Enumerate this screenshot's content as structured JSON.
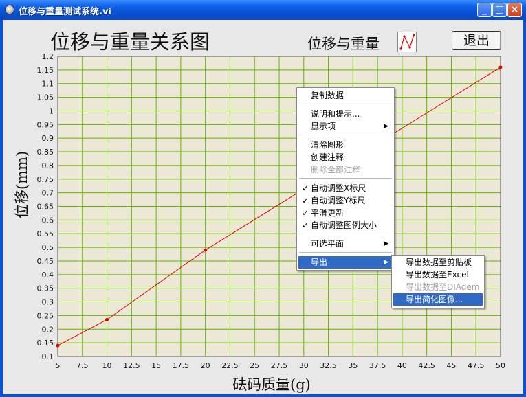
{
  "window": {
    "title": "位移与重量测试系统.vi"
  },
  "chart_title": "位移与重量关系图",
  "legend_label": "位移与重量",
  "exit_button": "退出",
  "context_menu": {
    "copy_data": "复制数据",
    "description": "说明和提示...",
    "visible_items": "显示项",
    "clear_graph": "清除图形",
    "create_annotation": "创建注释",
    "delete_annotations": "删除全部注释",
    "autoscale_x": "自动调整X标尺",
    "autoscale_y": "自动调整Y标尺",
    "smooth_update": "平滑更新",
    "autosize_legend": "自动调整图例大小",
    "transparent_plane": "可选平面",
    "export": "导出"
  },
  "export_submenu": {
    "to_clipboard": "导出数据至剪贴板",
    "to_excel": "导出数据至Excel",
    "to_diadem": "导出数据至DIAdem",
    "simplified_image": "导出简化图像..."
  },
  "colors": {
    "plot_bg": "#ede8d6",
    "grid": "#5cb800",
    "series": "#e00000",
    "titlebar": "#0a54d8",
    "menu_highlight": "#316ac5"
  },
  "chart_data": {
    "type": "line",
    "xlabel": "砝码质量(g)",
    "ylabel": "位移(mm)",
    "xlim": [
      5,
      50
    ],
    "ylim": [
      0.1,
      1.2
    ],
    "x_ticks": [
      "5",
      "7.5",
      "10",
      "12.5",
      "15",
      "17.5",
      "20",
      "22.5",
      "25",
      "27.5",
      "30",
      "32.5",
      "35",
      "37.5",
      "40",
      "42.5",
      "45",
      "47.5",
      "50"
    ],
    "y_ticks": [
      "0.1",
      "0.15",
      "0.2",
      "0.25",
      "0.3",
      "0.35",
      "0.4",
      "0.45",
      "0.5",
      "0.55",
      "0.6",
      "0.65",
      "0.7",
      "0.75",
      "0.8",
      "0.85",
      "0.9",
      "0.95",
      "1",
      "1.05",
      "1.1",
      "1.15",
      "1.2"
    ],
    "series": [
      {
        "x": [
          5,
          10,
          20,
          50
        ],
        "y": [
          0.14,
          0.235,
          0.49,
          1.16
        ]
      }
    ],
    "grid": true
  }
}
